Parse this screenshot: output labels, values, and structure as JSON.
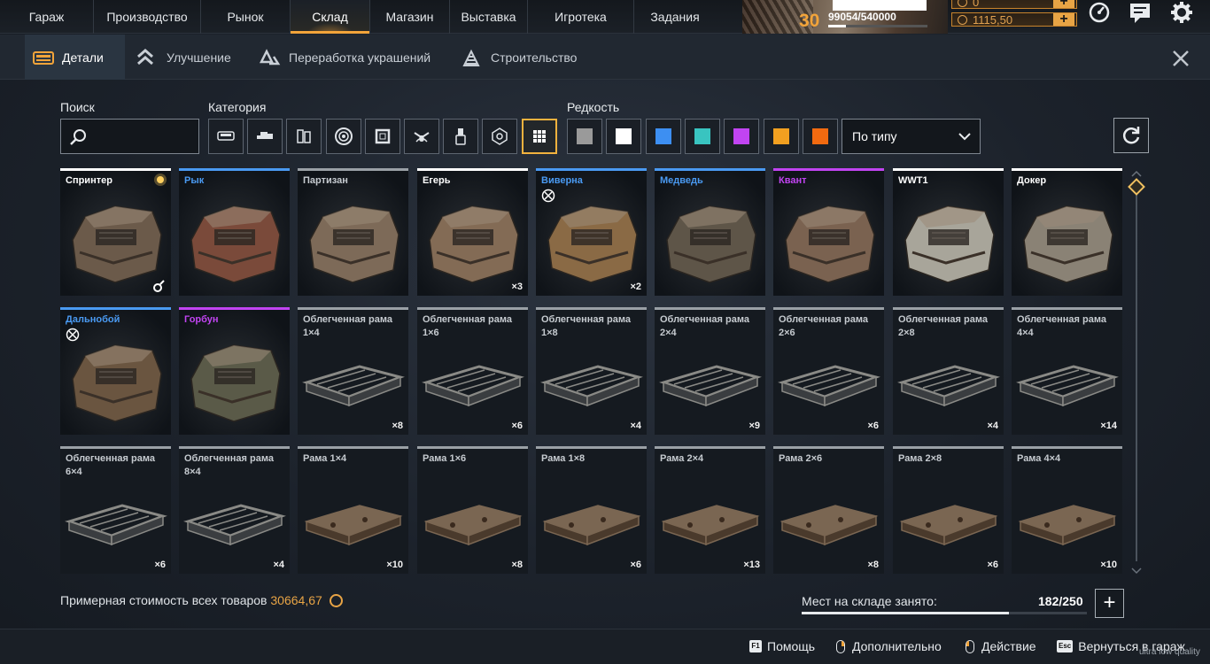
{
  "nav": {
    "items": [
      "Гараж",
      "Производство",
      "Рынок",
      "Склад",
      "Магазин",
      "Выставка",
      "Игротека",
      "Задания"
    ],
    "active": "Склад"
  },
  "player": {
    "level": "30",
    "xp": "99054/540000",
    "xp_progress": 0.18,
    "currency_top": "0",
    "currency_coins": "1115,50"
  },
  "subtabs": [
    "Детали",
    "Улучшение",
    "Переработка украшений",
    "Строительство"
  ],
  "filters": {
    "search_label": "Поиск",
    "search_placeholder": "",
    "category_label": "Категория",
    "categories": [
      "cabin-icon",
      "weapon-icon",
      "module-icon",
      "wheel-icon",
      "frame-icon",
      "drone-icon",
      "paint-icon",
      "decor-icon",
      "all-icon"
    ],
    "rarity_label": "Редкость",
    "rarities": [
      {
        "name": "common",
        "color": "#9a9a9a"
      },
      {
        "name": "white",
        "color": "#ffffff"
      },
      {
        "name": "rare",
        "color": "#3d8ff2"
      },
      {
        "name": "special",
        "color": "#39c4c0"
      },
      {
        "name": "epic",
        "color": "#c144f2"
      },
      {
        "name": "legendary",
        "color": "#f2a020"
      },
      {
        "name": "relic",
        "color": "#f26a10"
      }
    ],
    "sort_value": "По типу"
  },
  "items": [
    {
      "name": "Спринтер",
      "color": "#ffffff",
      "qty": "",
      "kind": "cabin"
    },
    {
      "name": "Рык",
      "color": "#4a9af2",
      "qty": "",
      "kind": "cabin"
    },
    {
      "name": "Партизан",
      "color": "#9aa0a6",
      "qty": "",
      "kind": "cabin"
    },
    {
      "name": "Егерь",
      "color": "#ffffff",
      "qty": "×3",
      "kind": "cabin"
    },
    {
      "name": "Виверна",
      "color": "#4a9af2",
      "qty": "×2",
      "kind": "cabin"
    },
    {
      "name": "Медведь",
      "color": "#4a9af2",
      "qty": "",
      "kind": "cabin"
    },
    {
      "name": "Квант",
      "color": "#c144f2",
      "qty": "",
      "kind": "cabin"
    },
    {
      "name": "WWT1",
      "color": "#ffffff",
      "qty": "",
      "kind": "cabin"
    },
    {
      "name": "Докер",
      "color": "#ffffff",
      "qty": "",
      "kind": "cabin"
    },
    {
      "name": "Дальнобой",
      "color": "#4a9af2",
      "qty": "",
      "kind": "cabin"
    },
    {
      "name": "Горбун",
      "color": "#c144f2",
      "qty": "",
      "kind": "cabin"
    },
    {
      "name": "Облегченная рама 1×4",
      "color": "#9aa0a6",
      "qty": "×8",
      "kind": "frame-light"
    },
    {
      "name": "Облегченная рама 1×6",
      "color": "#9aa0a6",
      "qty": "×6",
      "kind": "frame-light"
    },
    {
      "name": "Облегченная рама 1×8",
      "color": "#9aa0a6",
      "qty": "×4",
      "kind": "frame-light"
    },
    {
      "name": "Облегченная рама 2×4",
      "color": "#9aa0a6",
      "qty": "×9",
      "kind": "frame-light"
    },
    {
      "name": "Облегченная рама 2×6",
      "color": "#9aa0a6",
      "qty": "×6",
      "kind": "frame-light"
    },
    {
      "name": "Облегченная рама 2×8",
      "color": "#9aa0a6",
      "qty": "×4",
      "kind": "frame-light"
    },
    {
      "name": "Облегченная рама 4×4",
      "color": "#9aa0a6",
      "qty": "×14",
      "kind": "frame-light"
    },
    {
      "name": "Облегченная рама 6×4",
      "color": "#9aa0a6",
      "qty": "×6",
      "kind": "frame-light"
    },
    {
      "name": "Облегченная рама 8×4",
      "color": "#9aa0a6",
      "qty": "×4",
      "kind": "frame-light"
    },
    {
      "name": "Рама 1×4",
      "color": "#9aa0a6",
      "qty": "×10",
      "kind": "frame"
    },
    {
      "name": "Рама 1×6",
      "color": "#9aa0a6",
      "qty": "×8",
      "kind": "frame"
    },
    {
      "name": "Рама 1×8",
      "color": "#9aa0a6",
      "qty": "×6",
      "kind": "frame"
    },
    {
      "name": "Рама 2×4",
      "color": "#9aa0a6",
      "qty": "×13",
      "kind": "frame"
    },
    {
      "name": "Рама 2×6",
      "color": "#9aa0a6",
      "qty": "×8",
      "kind": "frame"
    },
    {
      "name": "Рама 2×8",
      "color": "#9aa0a6",
      "qty": "×6",
      "kind": "frame"
    },
    {
      "name": "Рама 4×4",
      "color": "#9aa0a6",
      "qty": "×10",
      "kind": "frame"
    }
  ],
  "footer": {
    "total_label": "Примерная стоимость всех товаров",
    "total_value": "30664,67",
    "storage_label": "Мест на складе занято:",
    "storage_count": "182/250",
    "storage_progress": 0.728
  },
  "bottom_hints": [
    {
      "key": "F1",
      "label": "Помощь"
    },
    {
      "key": "mouse-right",
      "label": "Дополнительно"
    },
    {
      "key": "mouse-left",
      "label": "Действие"
    },
    {
      "key": "Esc",
      "label": "Вернуться в гараж"
    }
  ],
  "quality_note": "ultra low quality"
}
